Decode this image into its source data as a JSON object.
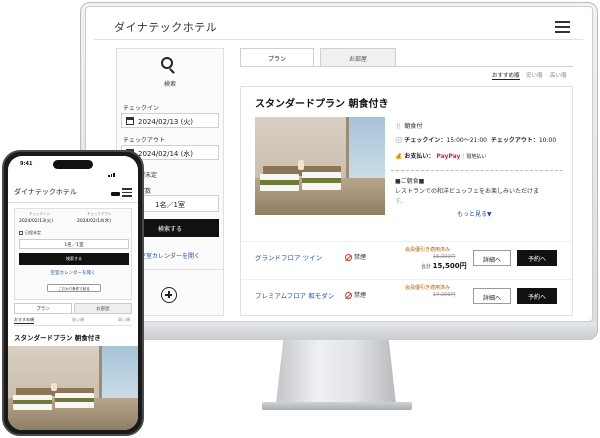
{
  "desktop": {
    "header": {
      "title": "ダイナテックホテル"
    },
    "sidebar": {
      "search_label": "検索",
      "checkin_label": "チェックイン",
      "checkin_value": "2024/02/13 (火)",
      "checkout_label": "チェックアウト",
      "checkout_value": "2024/02/14 (水)",
      "undecided_label": "程未定",
      "guests_label": "室数",
      "guests_value": "1名／1室",
      "search_button": "検索する",
      "calendar_link": "空室カレンダーを開く"
    },
    "tabs": [
      "プラン",
      "お部屋"
    ],
    "sort": [
      "おすすめ順",
      "安い順",
      "高い順"
    ],
    "plan": {
      "title": "スタンダードプラン 朝食付き",
      "meal": "朝食付",
      "checkin_label": "チェックイン：",
      "checkin_time": "15:00～21:00",
      "checkout_label": "チェックアウト：",
      "checkout_time": "10:00",
      "payment_label": "お支払い：",
      "payment_paypay": "PayPay",
      "payment_onsite": "現地払い",
      "breakfast_heading": "■ご朝食■",
      "breakfast_desc": "レストランでの和洋ビュッフェをお楽しみいただけま",
      "breakfast_desc_2": "す。",
      "more_link": "もっと見る▼"
    },
    "rooms": [
      {
        "name": "グランドフロア ツイン",
        "smoking": "禁煙",
        "member_label": "会員優引き適用済み",
        "old_price": "16,000円",
        "total_label": "合計",
        "price": "15,500円",
        "detail_button": "詳細へ",
        "reserve_button": "予約へ"
      },
      {
        "name": "プレミアムフロア 和モダン",
        "smoking": "禁煙",
        "member_label": "会員優引き適用済み",
        "old_price": "17,000円",
        "total_label": "",
        "price": "",
        "detail_button": "詳細へ",
        "reserve_button": "予約へ"
      }
    ]
  },
  "mobile": {
    "status_time": "9:41",
    "header": {
      "title": "ダイナテックホテル"
    },
    "checkin_label": "チェックイン",
    "checkin_value": "2024/02/13(火)",
    "checkout_label": "チェックアウト",
    "checkout_value": "2024/02/14(水)",
    "undecided_label": "日程未定",
    "guests_value": "1名／1室",
    "search_button": "検索する",
    "calendar_link": "空室カレンダーを開く",
    "more_button": "こだわり条件で絞る",
    "tabs": [
      "プラン",
      "お部屋"
    ],
    "sort": [
      "おすすめ順",
      "安い順",
      "高い順"
    ],
    "plan_title": "スタンダードプラン 朝食付き"
  },
  "icons": [
    "search-icon",
    "calendar-icon",
    "hamburger-menu-icon",
    "plus-icon",
    "no-smoking-icon",
    "meal-icon",
    "clock-icon",
    "wallet-icon"
  ]
}
